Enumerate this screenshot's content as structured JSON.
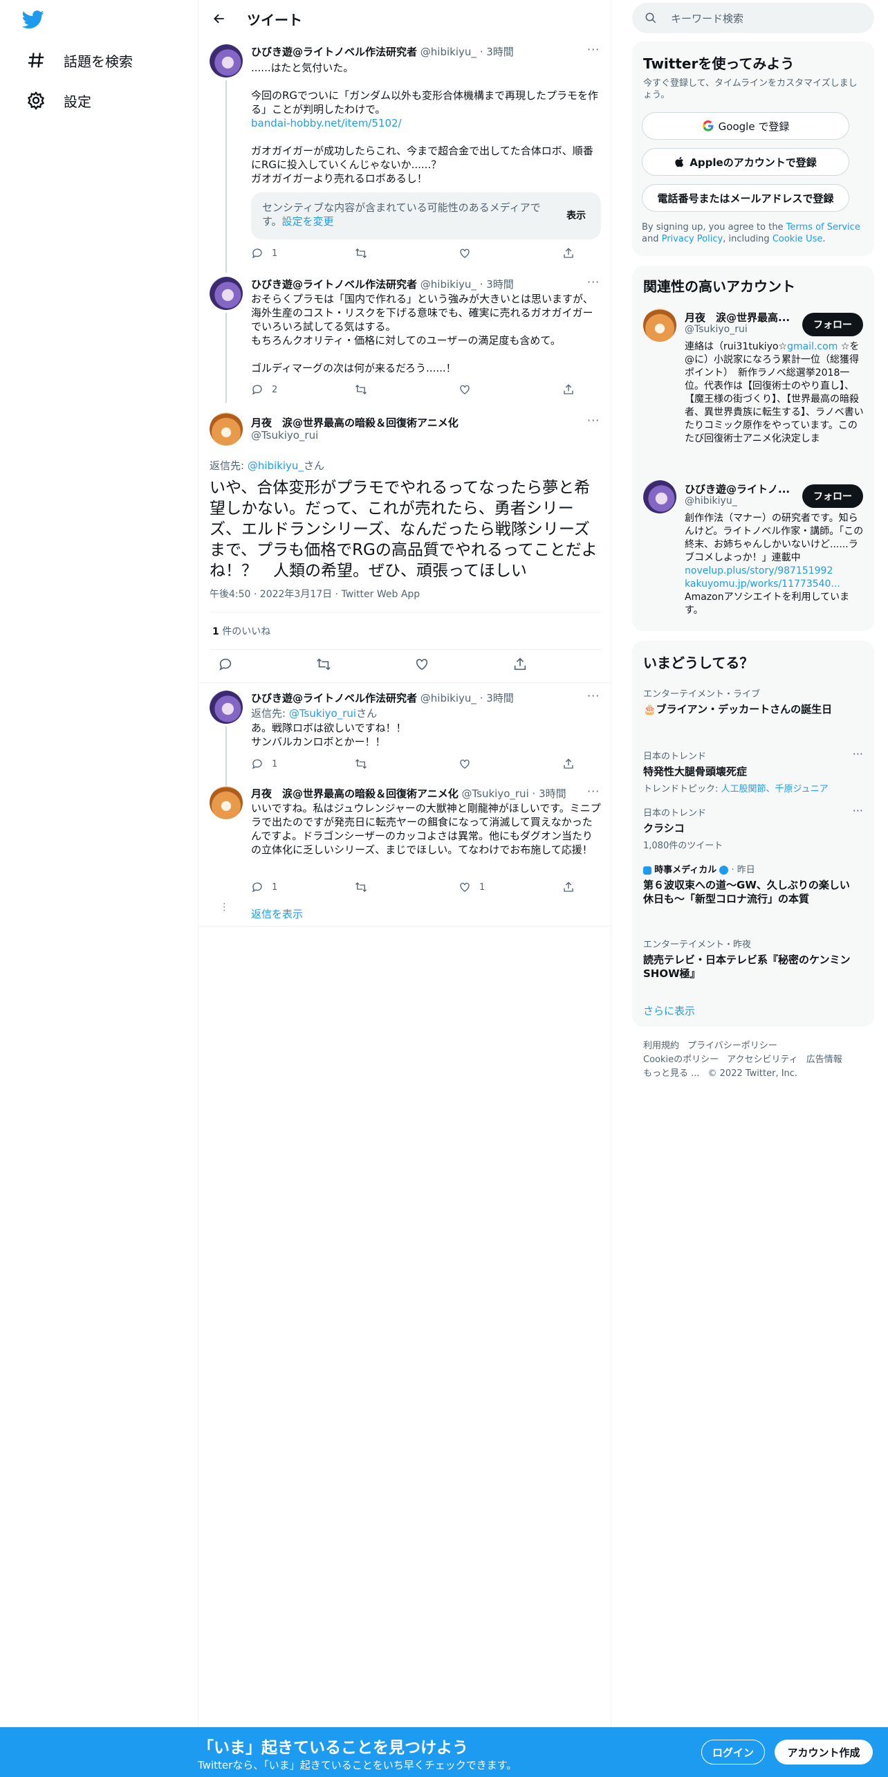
{
  "nav": {
    "explore": "話題を検索",
    "settings": "設定"
  },
  "header": {
    "title": "ツイート"
  },
  "tweets": [
    {
      "name": "ひびき遊@ライトノベル作法研究者",
      "handle": "@hibikiyu_",
      "time": "· 3時間",
      "text_before": "......はたと気付いた。\n\n今回のRGでついに「ガンダム以外も変形合体機構まで再現したプラモを作る」ことが判明したわけで。",
      "link": "bandai-hobby.net/item/5102/",
      "text_after": "ガオガイガーが成功したらこれ、今まで超合金で出してた合体ロボ、順番にRGに投入していくんじゃないか......？\nガオガイガーより売れるロボあるし！",
      "sensitive_text": "センシティブな内容が含まれている可能性のあるメディアです。",
      "sensitive_link": "設定を変更",
      "sensitive_show": "表示",
      "reply_count": "1"
    },
    {
      "name": "ひびき遊@ライトノベル作法研究者",
      "handle": "@hibikiyu_",
      "time": "· 3時間",
      "text": "おそらくプラモは「国内で作れる」という強みが大きいとは思いますが、海外生産のコスト・リスクを下げる意味でも、確実に売れるガオガイガーでいろいろ試してる気はする。\nもちろんクオリティ・価格に対してのユーザーの満足度も含めて。\n\nゴルディマーグの次は何が来るだろう......！",
      "reply_count": "2"
    }
  ],
  "main_tweet": {
    "name": "月夜　涙@世界最高の暗殺＆回復術アニメ化",
    "handle": "@Tsukiyo_rui",
    "reply_to_label": "返信先: ",
    "reply_to_handle": "@hibikiyu_",
    "reply_to_suffix": "さん",
    "text": "いや、合体変形がプラモでやれるってなったら夢と希望しかない。だって、これが売れたら、勇者シリーズ、エルドランシリーズ、なんだったら戦隊シリーズまで、プラも価格でRGの高品質でやれるってことだよね！？　人類の希望。ぜひ、頑張ってほしい",
    "timestamp": "午後4:50 · 2022年3月17日 · Twitter Web App",
    "likes_count": "1",
    "likes_label": "件のいいね"
  },
  "replies": [
    {
      "name": "ひびき遊@ライトノベル作法研究者",
      "handle": "@hibikiyu_",
      "time": "· 3時間",
      "reply_to_label": "返信先: ",
      "reply_to_handle": "@Tsukiyo_rui",
      "reply_to_suffix": "さん",
      "text": "あ。戦隊ロボは欲しいですね！！\nサンバルカンロボとかー！！",
      "reply_count": "1"
    },
    {
      "name": "月夜　涙@世界最高の暗殺＆回復術アニメ化",
      "handle": "@Tsukiyo_rui",
      "time": "· 3時間",
      "text": "いいですね。私はジュウレンジャーの大獣神と剛龍神がほしいです。ミニプラで出たのですが発売日に転売ヤーの餌食になって消滅して買えなかったんですよ。ドラゴンシーザーのカッコよさは異常。他にもダグオン当たりの立体化に乏しいシリーズ、まじでほしい。てなわけでお布施して応援！",
      "reply_count": "1",
      "like_count": "1"
    }
  ],
  "show_replies": "返信を表示",
  "search": {
    "placeholder": "キーワード検索"
  },
  "signup_card": {
    "title": "Twitterを使ってみよう",
    "subtitle": "今すぐ登録して、タイムラインをカスタマイズしましょう。",
    "google": "Google で登録",
    "apple": "Appleのアカウントで登録",
    "phone": "電話番号またはメールアドレスで登録",
    "legal_1": "By signing up, you agree to the ",
    "terms": "Terms of Service",
    "legal_2": " and ",
    "privacy": "Privacy Policy",
    "legal_3": ", including ",
    "cookie": "Cookie Use",
    "legal_4": "."
  },
  "related": {
    "title": "関連性の高いアカウント",
    "accounts": [
      {
        "name": "月夜　涙@世界最高...",
        "handle": "@Tsukiyo_rui",
        "follow": "フォロー",
        "bio_1": "連絡は（rui31tukiyo☆",
        "bio_link": "gmail.com",
        "bio_2": " ☆を@に）小説家になろう累計一位（総獲得ポイント）　新作ラノベ総選挙2018一位。代表作は【回復術士のやり直し】、【魔王様の街づくり】、【世界最高の暗殺者、異世界貴族に転生する】、ラノベ書いたりコミック原作をやっています。このたび回復術士アニメ化決定しま"
      },
      {
        "name": "ひびき遊@ライトノ...",
        "handle": "@hibikiyu_",
        "follow": "フォロー",
        "bio_1": "創作作法（マナー）の研究者です。知らんけど。ライトノベル作家・講師。「この終末、お姉ちゃんしかいないけど......ラブコメしよっか！」連載中 ",
        "bio_link": "novelup.plus/story/987151992",
        "bio_link2": "kakuyomu.jp/works/11773540...",
        "bio_2": "Amazonアソシエイトを利用しています。"
      }
    ]
  },
  "trends": {
    "title": "いまどうしてる？",
    "items": [
      {
        "context": "エンターテイメント・ライブ",
        "title": "🎂ブライアン・デッカートさんの誕生日"
      },
      {
        "context": "日本のトレンド",
        "title": "特発性大腿骨頭壊死症",
        "sub_label": "トレンドトピック: ",
        "sub_link": "人工股関節、千原ジュニア"
      },
      {
        "context": "日本のトレンド",
        "title": "クラシコ",
        "sub": "1,080件のツイート"
      },
      {
        "context_source": "時事メディカル",
        "context_time": "· 昨日",
        "title": "第６波収束への道～GW、久しぶりの楽しい休日も～「新型コロナ流行」の本質"
      },
      {
        "context": "エンターテイメント・昨夜",
        "title": "読売テレビ・日本テレビ系『秘密のケンミンSHOW極』"
      }
    ],
    "show_more": "さらに表示"
  },
  "footer": {
    "terms": "利用規約",
    "privacy": "プライバシーポリシー",
    "cookie": "Cookieのポリシー",
    "accessibility": "アクセシビリティ",
    "ads": "広告情報",
    "more": "もっと見る ...",
    "copyright": "© 2022 Twitter, Inc."
  },
  "bottom_bar": {
    "title": "「いま」起きていることを見つけよう",
    "subtitle": "Twitterなら、「いま」起きていることをいち早くチェックできます。",
    "login": "ログイン",
    "signup": "アカウント作成"
  },
  "colors": {
    "accent": "#1d9bf0",
    "text": "#0f1419",
    "secondary": "#536471"
  }
}
